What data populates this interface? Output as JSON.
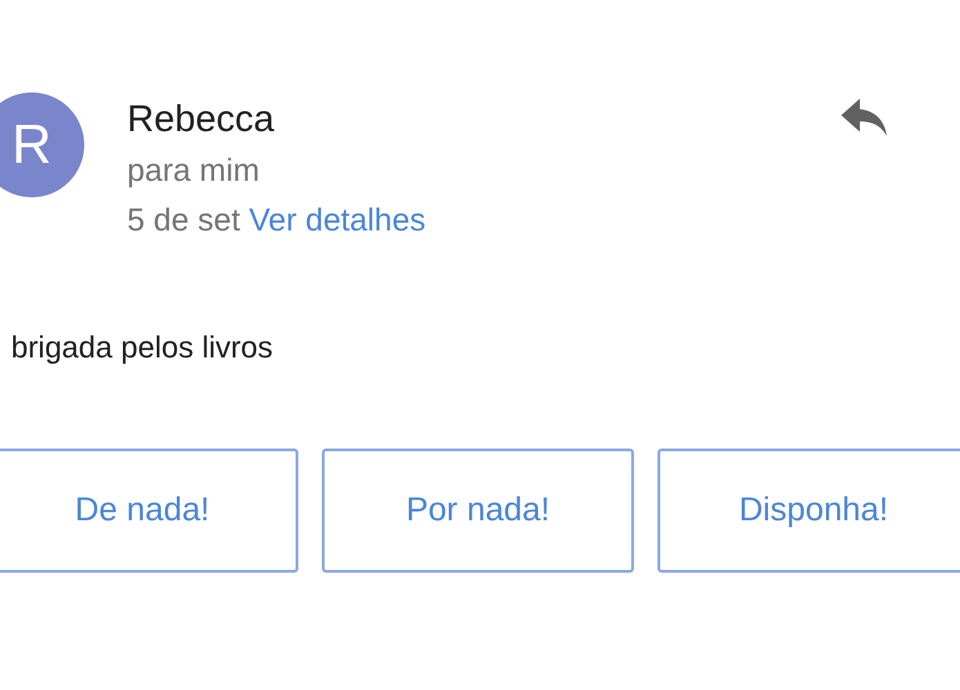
{
  "sender": {
    "initial": "R",
    "name": "Rebecca",
    "recipient": "para mim",
    "date": "5 de set",
    "details_link": "Ver detalhes"
  },
  "body": "brigada pelos livros",
  "smart_replies": [
    "De nada!",
    "Por nada!",
    "Disponha!"
  ]
}
